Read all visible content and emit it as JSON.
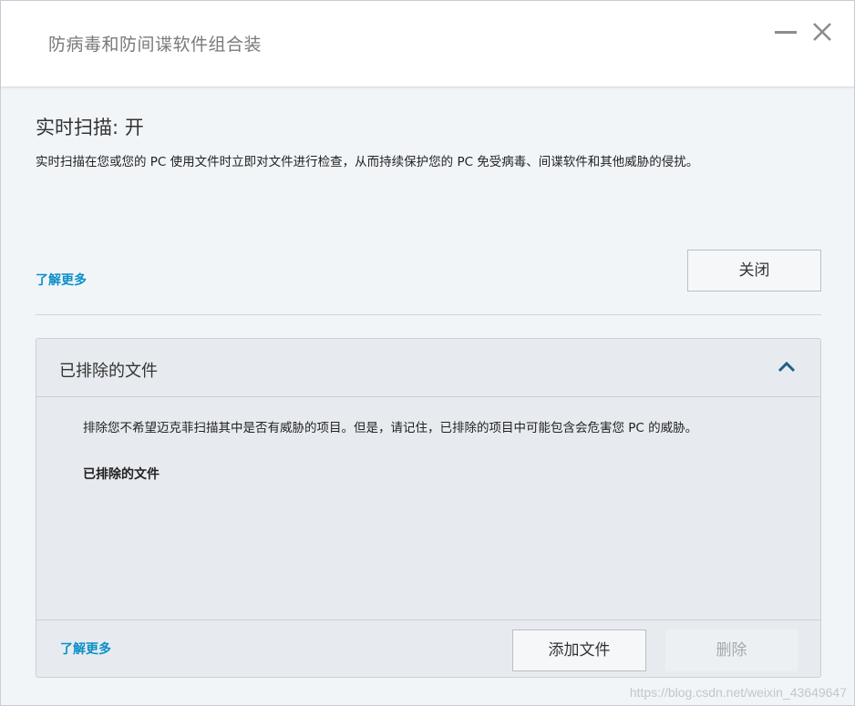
{
  "window": {
    "title": "防病毒和防间谍软件组合装",
    "minimize_icon": "minimize-icon",
    "close_icon": "close-icon"
  },
  "realtime": {
    "heading": "实时扫描: 开",
    "description": "实时扫描在您或您的 PC 使用文件时立即对文件进行检查，从而持续保护您的 PC 免受病毒、间谍软件和其他威胁的侵扰。",
    "learn_more": "了解更多",
    "close_button": "关闭"
  },
  "excluded": {
    "title": "已排除的文件",
    "chevron_icon": "chevron-up-icon",
    "description": "排除您不希望迈克菲扫描其中是否有威胁的项目。但是，请记住，已排除的项目中可能包含会危害您 PC 的威胁。",
    "subheading": "已排除的文件",
    "learn_more": "了解更多",
    "add_button": "添加文件",
    "delete_button": "删除"
  },
  "watermark": "https://blog.csdn.net/weixin_43649647",
  "colors": {
    "link": "#0b8fc8",
    "chevron": "#1f5f8b",
    "disabled_text": "#a5aab0"
  }
}
